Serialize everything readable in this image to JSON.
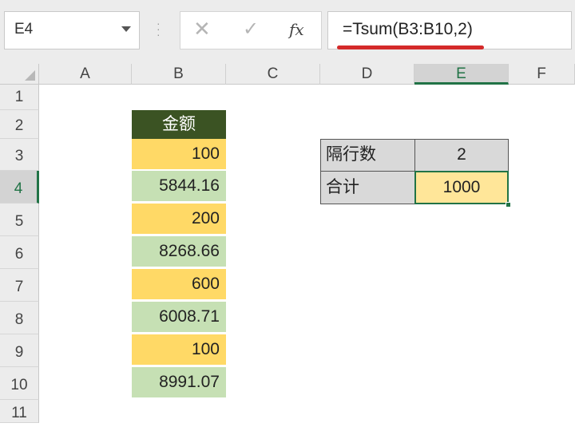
{
  "name_box": "E4",
  "formula_bar": {
    "cancel_glyph": "✕",
    "enter_glyph": "✓",
    "fx_label": "fx",
    "formula": "=Tsum(B3:B10,2)"
  },
  "columns": [
    "A",
    "B",
    "C",
    "D",
    "E",
    "F"
  ],
  "rows": [
    "1",
    "2",
    "3",
    "4",
    "5",
    "6",
    "7",
    "8",
    "9",
    "10",
    "11"
  ],
  "selected_column": "E",
  "selected_row": "4",
  "column_b": {
    "header": "金额",
    "values": [
      "100",
      "5844.16",
      "200",
      "8268.66",
      "600",
      "6008.71",
      "100",
      "8991.07"
    ]
  },
  "side_table": {
    "rows": [
      {
        "label": "隔行数",
        "value": "2"
      },
      {
        "label": "合计",
        "value": "1000"
      }
    ]
  },
  "colors": {
    "header_green": "#3b5323",
    "amber_fill": "#ffd966",
    "green_fill": "#c6e0b4",
    "selection_green": "#217346",
    "formula_underline": "#d42a2a"
  }
}
